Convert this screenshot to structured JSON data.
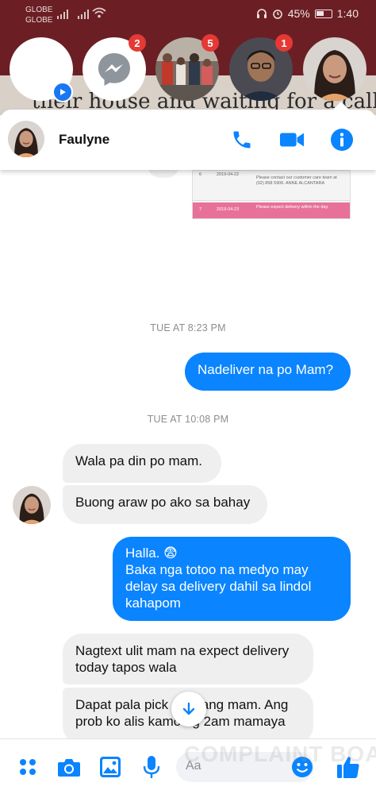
{
  "status_bar": {
    "carrier_1": "GLOBE",
    "carrier_2": "GLOBE",
    "battery": "45%",
    "time": "1:40"
  },
  "backdrop": {
    "peek_text": "their house and waiting for a call or text. Bu"
  },
  "chat_heads": [
    {
      "name": "blank-head",
      "badge": ""
    },
    {
      "name": "messenger-head",
      "badge": "2"
    },
    {
      "name": "group-head",
      "badge": "5"
    },
    {
      "name": "man-head",
      "badge": "1"
    },
    {
      "name": "faulyne-head",
      "badge": ""
    }
  ],
  "conversation": {
    "contact_name": "Faulyne",
    "header_icons": [
      "phone-icon",
      "video-camera-icon",
      "info-icon"
    ]
  },
  "shared_image": {
    "rows": [
      {
        "no": "6",
        "date": "2019-04-22",
        "text": "Please contact our customer care team at (02) 858 5906. ANNE ALCANTARA"
      },
      {
        "no": "7",
        "date": "2019-04-23",
        "text": "Please expect delivery within the day."
      }
    ]
  },
  "messages": {
    "ts_1": "TUE AT 8:23 PM",
    "out_1": "Nadeliver na po Mam?",
    "ts_2": "TUE AT 10:08 PM",
    "in_1": "Wala pa din po mam.",
    "in_2": "Buong araw po ako sa bahay",
    "out_2_line1": "Halla. 😨",
    "out_2_line2": "Baka nga totoo na medyo may delay sa delivery dahil sa lindol kahapom",
    "in_3": "Nagtext ulit mam na expect delivery today tapos wala",
    "in_4": "Dapat pala pick    o nalang mam. Ang prob ko alis    kamo ng 2am mamaya"
  },
  "composer": {
    "placeholder": "Aa",
    "icons": [
      "menu-dots-icon",
      "camera-icon",
      "gallery-icon",
      "microphone-icon",
      "emoji-icon",
      "thumbs-up-icon"
    ]
  },
  "watermark": "COMPLAINT BOARD",
  "colors": {
    "accent": "#0a84ff",
    "backdrop": "#6b1f24",
    "badge": "#e53935"
  }
}
